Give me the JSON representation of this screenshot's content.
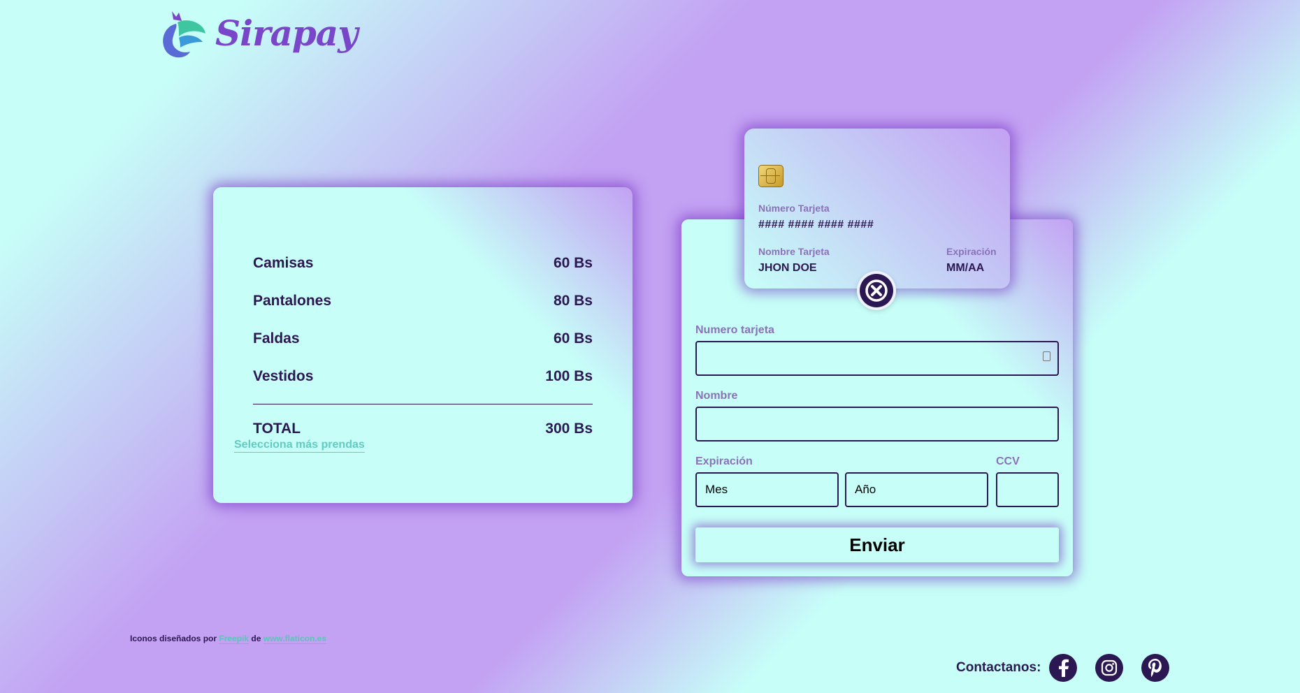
{
  "brand": {
    "name": "Sirapay"
  },
  "summary": {
    "items": [
      {
        "name": "Camisas",
        "price": "60 Bs"
      },
      {
        "name": "Pantalones",
        "price": "80 Bs"
      },
      {
        "name": "Faldas",
        "price": "60 Bs"
      },
      {
        "name": "Vestidos",
        "price": "100 Bs"
      }
    ],
    "total_label": "TOTAL",
    "total_value": "300 Bs",
    "more_link": "Selecciona más prendas"
  },
  "card_preview": {
    "number_label": "Número Tarjeta",
    "number_value": "#### #### #### ####",
    "name_label": "Nombre Tarjeta",
    "name_value": "JHON DOE",
    "expiry_label": "Expiración",
    "expiry_value": "MM/AA"
  },
  "form": {
    "card_number_label": "Numero tarjeta",
    "card_number_value": "",
    "name_label": "Nombre",
    "name_value": "",
    "expiry_label": "Expiración",
    "month_value": "Mes",
    "year_value": "Año",
    "ccv_label": "CCV",
    "ccv_value": "",
    "submit_label": "Enviar"
  },
  "footer": {
    "credits_prefix": "Iconos diseñados por",
    "credits_author": "Freepik",
    "credits_mid": "de",
    "credits_site": "www.flaticon.es",
    "contact_label": "Contactanos:",
    "social_icons": [
      "facebook-icon",
      "instagram-icon",
      "pinterest-icon"
    ]
  },
  "colors": {
    "primary_dark": "#2b1752",
    "mint": "#c7fff8",
    "lavender": "#c3a1f3",
    "link": "#5cc4b8",
    "label": "#8a72b8"
  }
}
